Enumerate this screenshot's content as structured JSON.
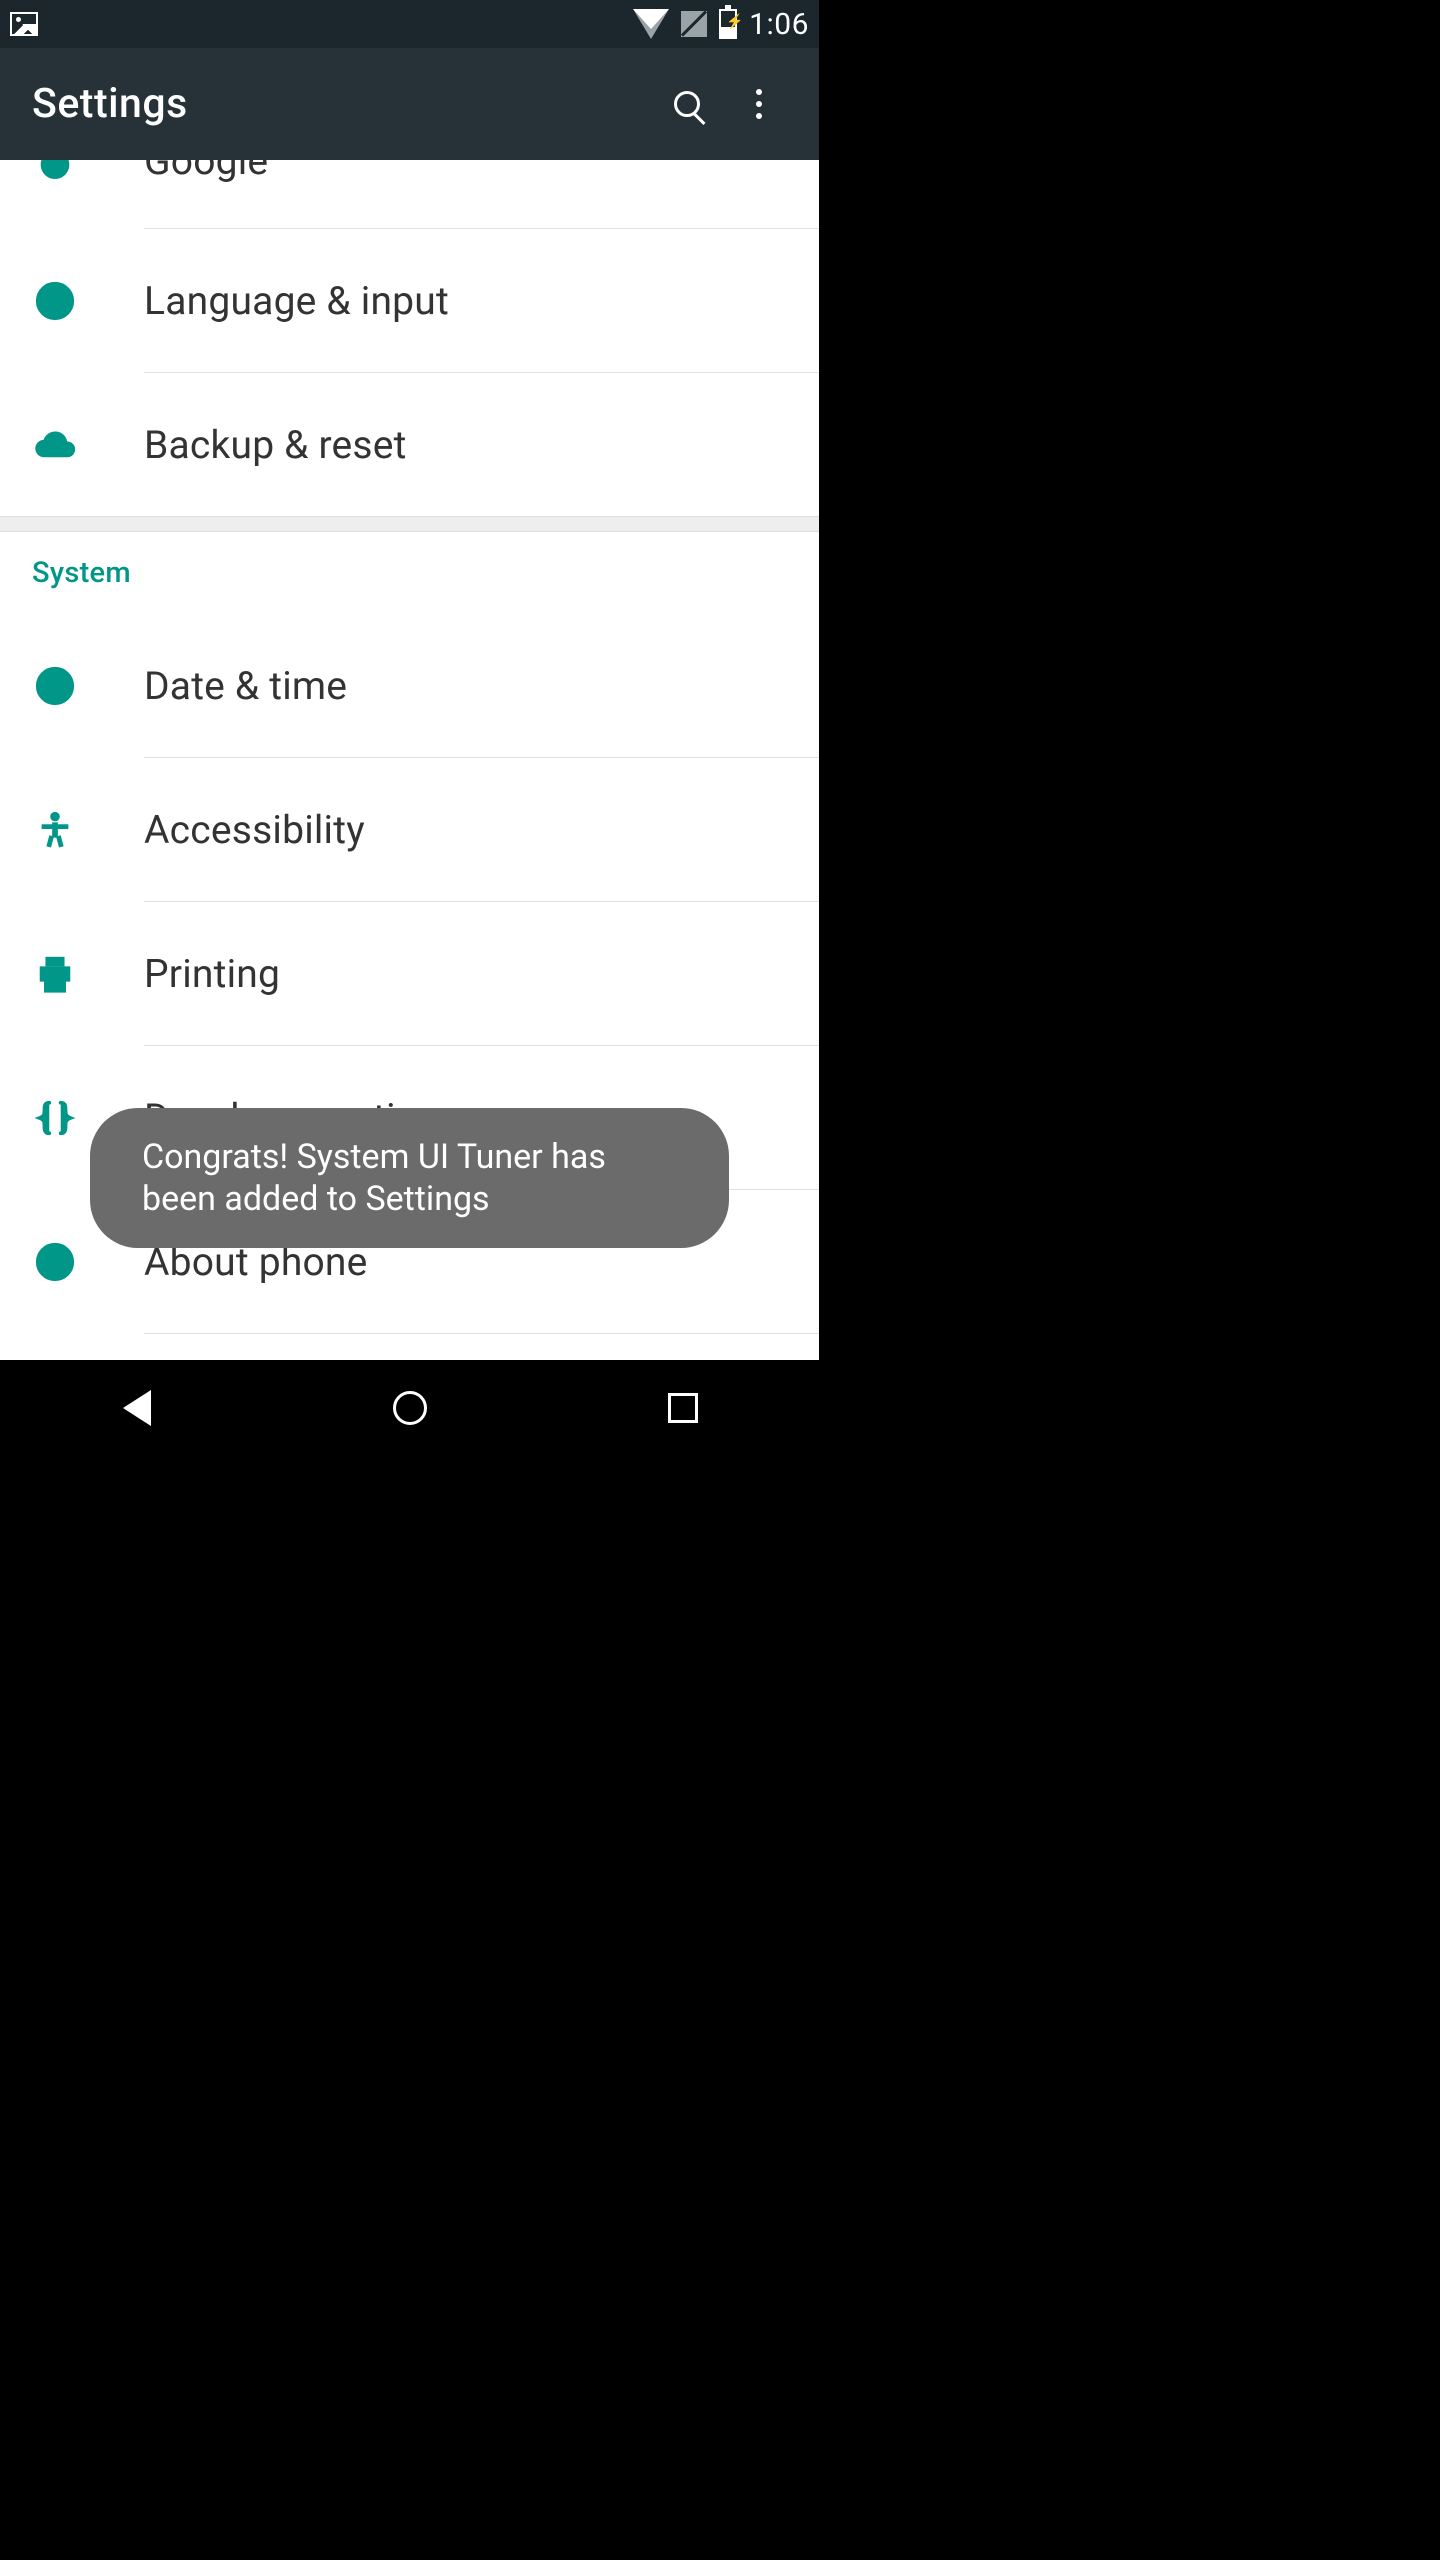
{
  "statusbar": {
    "time": "1:06"
  },
  "appbar": {
    "title": "Settings"
  },
  "rows": {
    "google": {
      "label": "Google",
      "icon": "google-icon"
    },
    "language": {
      "label": "Language & input",
      "icon": "globe-icon"
    },
    "backup": {
      "label": "Backup & reset",
      "icon": "cloud-upload-icon"
    },
    "datetime": {
      "label": "Date & time",
      "icon": "clock-icon"
    },
    "accessibility": {
      "label": "Accessibility",
      "icon": "accessibility-icon"
    },
    "printing": {
      "label": "Printing",
      "icon": "printer-icon"
    },
    "developer": {
      "label": "Developer options",
      "icon": "braces-icon"
    },
    "about": {
      "label": "About phone",
      "icon": "info-icon"
    }
  },
  "section": {
    "system": "System"
  },
  "toast": {
    "text": "Congrats! System UI Tuner has been added to Settings"
  }
}
